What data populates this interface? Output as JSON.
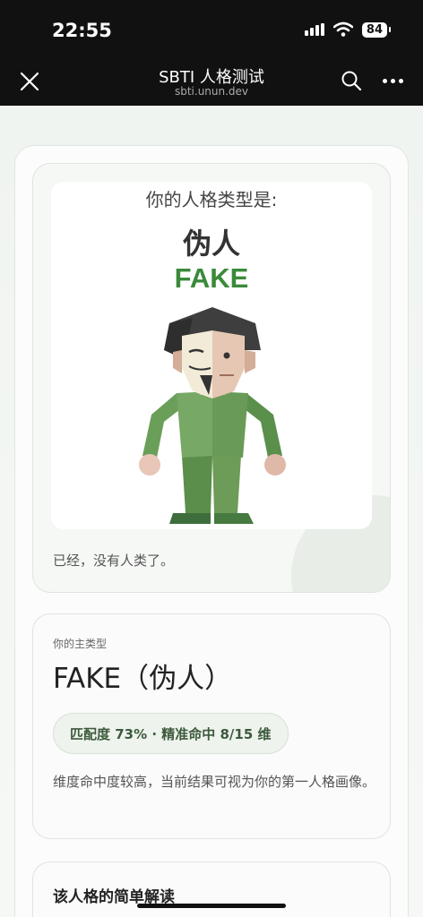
{
  "status": {
    "time": "22:55",
    "battery": "84"
  },
  "nav": {
    "title": "SBTI 人格测试",
    "domain": "sbti.unun.dev"
  },
  "poster": {
    "question": "你的人格类型是:",
    "type_cn": "伪人",
    "type_en": "FAKE",
    "caption": "已经，没有人类了。"
  },
  "main_type": {
    "label": "你的主类型",
    "name": "FAKE（伪人）",
    "match": "匹配度 73% · 精准命中 8/15 维",
    "description": "维度命中度较高，当前结果可视为你的第一人格画像。"
  },
  "interpretation": {
    "title": "该人格的简单解读"
  },
  "colors": {
    "accent_green": "#3a8a3a",
    "nav_bg": "#111111"
  }
}
